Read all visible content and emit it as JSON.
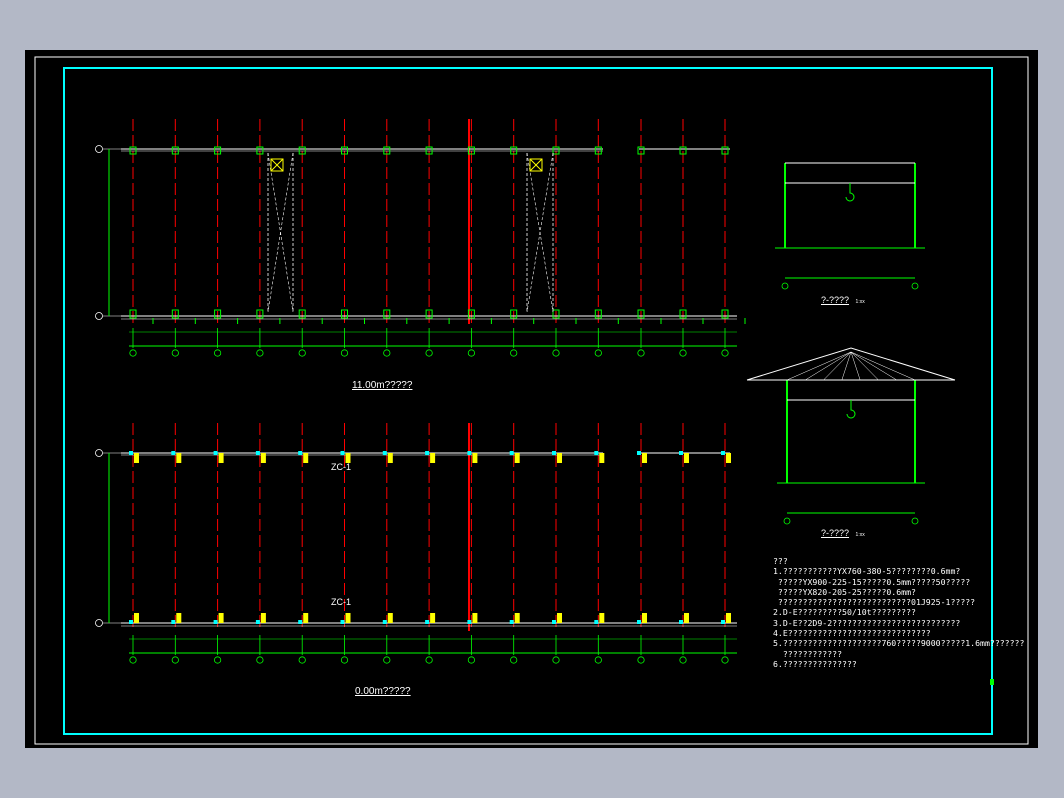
{
  "plans": {
    "upper_title": "11.00m?????",
    "lower_title": "0.00m?????",
    "zc_label": "ZC-1"
  },
  "sections": {
    "top_title": "?-????",
    "top_scale": "1:xx",
    "bottom_title": "?-????",
    "bottom_scale": "1:xx"
  },
  "notes": {
    "heading": "???",
    "lines": [
      "1.???????????YX760-380-5????????0.6mm?",
      " ?????YX900-225-15?????0.5mm?????50?????",
      " ?????YX820-205-25?????0.6mm?",
      " ???????????????????????????01J925-1?????",
      "2.D-E?????????50/10t?????????",
      "3.D-E??2D9-2??????????????????????????",
      "4.E?????????????????????????????",
      "5.????????????????????760?????9000?????1.6mm???????",
      "  ????????????",
      "6.???????????????"
    ]
  },
  "colors": {
    "frame_cyan": "#00ffff",
    "grid_red": "#ff0000",
    "structure_green": "#00ff00",
    "column_yellow": "#ffff00",
    "text_white": "#ffffff"
  }
}
